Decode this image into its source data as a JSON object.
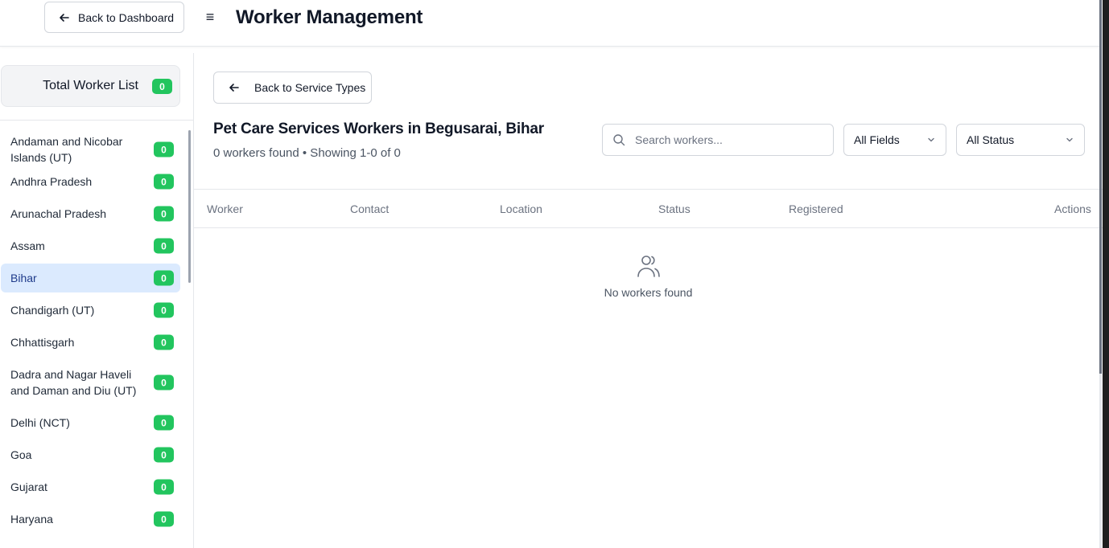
{
  "header": {
    "back_label": "Back to Dashboard",
    "menu_icon": "menu-icon",
    "title": "Worker Management"
  },
  "sidebar": {
    "total_label": "Total Worker List",
    "total_count": "0",
    "items": [
      {
        "label": "Andaman and Nicobar Islands (UT)",
        "count": "0",
        "active": false
      },
      {
        "label": "Andhra Pradesh",
        "count": "0",
        "active": false
      },
      {
        "label": "Arunachal Pradesh",
        "count": "0",
        "active": false
      },
      {
        "label": "Assam",
        "count": "0",
        "active": false
      },
      {
        "label": "Bihar",
        "count": "0",
        "active": true
      },
      {
        "label": "Chandigarh (UT)",
        "count": "0",
        "active": false
      },
      {
        "label": "Chhattisgarh",
        "count": "0",
        "active": false
      },
      {
        "label": "Dadra and Nagar Haveli and Daman and Diu (UT)",
        "count": "0",
        "active": false
      },
      {
        "label": "Delhi (NCT)",
        "count": "0",
        "active": false
      },
      {
        "label": "Goa",
        "count": "0",
        "active": false
      },
      {
        "label": "Gujarat",
        "count": "0",
        "active": false
      },
      {
        "label": "Haryana",
        "count": "0",
        "active": false
      }
    ]
  },
  "main": {
    "back_label": "Back to Service Types",
    "heading": "Pet Care Services Workers in Begusarai, Bihar",
    "subheading": "0 workers found • Showing 1-0 of 0",
    "search_placeholder": "Search workers...",
    "field_filter": "All Fields",
    "status_filter": "All Status",
    "columns": [
      "Worker",
      "Contact",
      "Location",
      "Status",
      "Registered",
      "Actions"
    ],
    "empty_icon": "users-icon",
    "empty_text": "No workers found"
  },
  "colors": {
    "badge": "#22c55e",
    "active_bg": "#dbeafe",
    "border": "#e5e7eb"
  }
}
